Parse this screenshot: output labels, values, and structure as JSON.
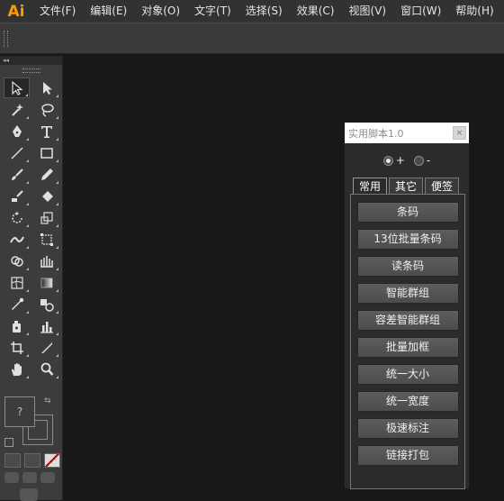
{
  "app": {
    "logo_text": "Ai",
    "logo_color": "#ff9a00"
  },
  "menu": [
    "文件(F)",
    "编辑(E)",
    "对象(O)",
    "文字(T)",
    "选择(S)",
    "效果(C)",
    "视图(V)",
    "窗口(W)",
    "帮助(H)"
  ],
  "tools_panel": {
    "collapse_glyph": "◂◂",
    "tools": [
      "selection-tool",
      "direct-selection-tool",
      "magic-wand-tool",
      "lasso-tool",
      "pen-tool",
      "type-tool",
      "line-segment-tool",
      "rectangle-tool",
      "paintbrush-tool",
      "pencil-tool",
      "blob-brush-tool",
      "eraser-tool",
      "rotate-tool",
      "scale-tool",
      "width-tool",
      "free-transform-tool",
      "shape-builder-tool",
      "perspective-grid-tool",
      "mesh-tool",
      "gradient-tool",
      "eyedropper-tool",
      "blend-tool",
      "symbol-sprayer-tool",
      "column-graph-tool",
      "artboard-tool",
      "slice-tool",
      "hand-tool",
      "zoom-tool"
    ],
    "fill_placeholder": "?"
  },
  "script_panel": {
    "title": "实用脚本1.0",
    "close_glyph": "×",
    "radio_plus": "+",
    "radio_minus": "-",
    "tabs": [
      "常用",
      "其它",
      "便签"
    ],
    "buttons": [
      "条码",
      "13位批量条码",
      "读条码",
      "智能群组",
      "容差智能群组",
      "批量加框",
      "统一大小",
      "统一宽度",
      "极速标注",
      "链接打包"
    ]
  }
}
